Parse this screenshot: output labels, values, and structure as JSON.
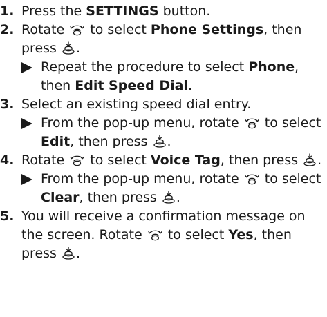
{
  "steps": [
    {
      "num": "1.",
      "t1": "Press the ",
      "b1": "SETTINGS",
      "t2": " button."
    },
    {
      "num": "2.",
      "t1": "Rotate ",
      "t2": " to select ",
      "b1": "Phone Settings",
      "t3": ", then press ",
      "t4": ".",
      "sub": {
        "t1": "Repeat the procedure to select ",
        "b1": "Phone",
        "t2": ", then ",
        "b2": "Edit Speed Dial",
        "t3": "."
      }
    },
    {
      "num": "3.",
      "t1": "Select an existing speed dial entry.",
      "sub": {
        "t1": "From the pop-up menu, rotate ",
        "t2": " to select ",
        "b1": "Edit",
        "t3": ", then press ",
        "t4": "."
      }
    },
    {
      "num": "4.",
      "t1": "Rotate ",
      "t2": " to select ",
      "b1": "Voice Tag",
      "t3": ", then press ",
      "t4": ".",
      "sub": {
        "t1": "From the pop-up menu, rotate ",
        "t2": " to select ",
        "b1": "Clear",
        "t3": ", then press ",
        "t4": "."
      }
    },
    {
      "num": "5.",
      "t1": "You will receive a confirmation message on the screen. Rotate ",
      "t2": " to select ",
      "b1": "Yes",
      "t3": ", then press ",
      "t4": "."
    }
  ],
  "icons": {
    "rotate": "rotate-knob-icon",
    "press": "press-knob-icon"
  }
}
